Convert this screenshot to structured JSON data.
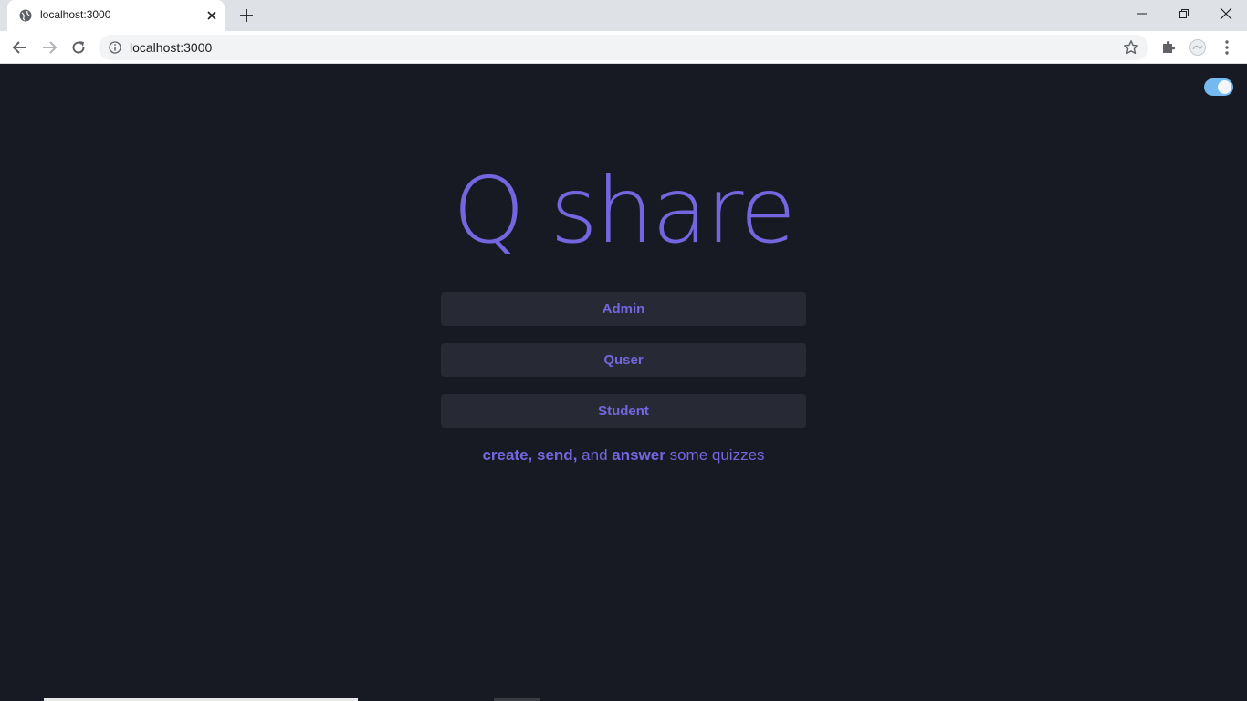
{
  "browser": {
    "tab_title": "localhost:3000",
    "url": "localhost:3000",
    "icons": {
      "favicon": "globe-icon",
      "tab_close": "close-icon",
      "new_tab": "plus-icon",
      "back": "arrow-left-icon",
      "forward": "arrow-right-icon",
      "reload": "reload-icon",
      "site_info": "info-icon",
      "bookmark": "star-icon",
      "extensions": "puzzle-icon",
      "profile": "profile-icon",
      "menu": "kebab-menu-icon"
    }
  },
  "page": {
    "theme_toggle_on": true,
    "title": "Q share",
    "roles": [
      {
        "label": "Admin"
      },
      {
        "label": "Quser"
      },
      {
        "label": "Student"
      }
    ],
    "tagline": {
      "create": "create,",
      "send": "send,",
      "and": "and",
      "answer": "answer",
      "rest": "some quizzes"
    }
  },
  "colors": {
    "background": "#181a23",
    "accent": "#7466df",
    "button_bg": "#272a34",
    "toggle": "#74b9f0"
  }
}
